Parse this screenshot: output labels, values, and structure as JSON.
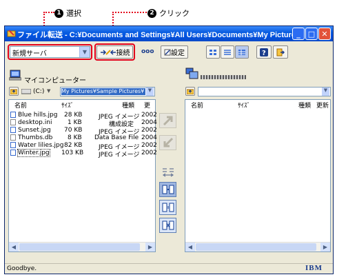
{
  "annotations": {
    "step1": {
      "num": "1",
      "label": "選択"
    },
    "step2": {
      "num": "2",
      "label": "クリック"
    }
  },
  "window": {
    "title": "ファイル転送 - C:¥Documents and Settings¥All Users¥Documents¥My Pictures¥S...",
    "min": "_",
    "max": "□",
    "close": "✕"
  },
  "toolbar": {
    "server_value": "新規サーバ",
    "connect_label": "接続",
    "dots": "ooo",
    "settings_label": "設定"
  },
  "left_pane": {
    "title": "マイコンピューター",
    "drive": "(C:)",
    "path": "My Pictures¥Sample Pictures¥",
    "columns": [
      "名前",
      "ｻｲｽﾞ",
      "種類",
      "更"
    ],
    "files": [
      {
        "name": "Blue hills.jpg",
        "size": "28 KB",
        "type": "JPEG イメージ",
        "date": "2002"
      },
      {
        "name": "desktop.ini",
        "size": "1 KB",
        "type": "構成設定",
        "date": "2004"
      },
      {
        "name": "Sunset.jpg",
        "size": "70 KB",
        "type": "JPEG イメージ",
        "date": "2002"
      },
      {
        "name": "Thumbs.db",
        "size": "8 KB",
        "type": "Data Base File",
        "date": "2004"
      },
      {
        "name": "Water lilies.jpg",
        "size": "82 KB",
        "type": "JPEG イメージ",
        "date": "2002"
      },
      {
        "name": "Winter.jpg",
        "size": "103 KB",
        "type": "JPEG イメージ",
        "date": "2002"
      }
    ]
  },
  "right_pane": {
    "columns": [
      "名前",
      "ｻｲｽﾞ",
      "種類",
      "更新"
    ]
  },
  "status": {
    "text": "Goodbye.",
    "brand": "IBM"
  }
}
